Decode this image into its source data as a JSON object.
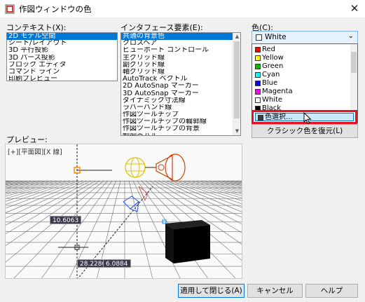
{
  "window": {
    "title": "作図ウィンドウの色",
    "close_glyph": "✕"
  },
  "context": {
    "label": "コンテキスト(X):",
    "items": [
      "2D モデル空間",
      "シート/レイアウト",
      "3D 平行投影",
      "3D パース投影",
      "ブロック エディタ",
      "コマンド ライン",
      "印刷プレビュー"
    ],
    "selected_index": 0
  },
  "interface": {
    "label": "インタフェース要素(E):",
    "items": [
      "共通の背景色",
      "クロスヘア",
      "ビューポート コントロール",
      "主グリッド線",
      "副グリッド線",
      "軸グリッド線",
      "AutoTrack ベクトル",
      "2D AutoSnap マーカー",
      "3D AutoSnap マーカー",
      "ダイナミック寸法線",
      "ラバーバンド線",
      "作図ツールチップ",
      "作図ツールチップの輪郭線",
      "作図ツールチップの背景",
      "制御点ハル"
    ],
    "selected_index": 0
  },
  "color": {
    "label": "色(C):",
    "current": "White",
    "current_color": "#ffffff",
    "options": [
      {
        "name": "Red",
        "color": "#ff0000"
      },
      {
        "name": "Yellow",
        "color": "#ffff00"
      },
      {
        "name": "Green",
        "color": "#00c000"
      },
      {
        "name": "Cyan",
        "color": "#00ffff"
      },
      {
        "name": "Blue",
        "color": "#0000ff"
      },
      {
        "name": "Magenta",
        "color": "#ff00ff"
      },
      {
        "name": "White",
        "color": "#ffffff"
      },
      {
        "name": "Black",
        "color": "#000000"
      }
    ],
    "select_color": "色選択...",
    "restore_button": "クラシック色を復元(L)",
    "highlight_color": "#e81123"
  },
  "preview": {
    "label": "プレビュー:",
    "viewport_label": "[+][平面図][X 線]",
    "coord_1": "10.6063",
    "coord_2": "28.2280",
    "coord_3": "6.0884"
  },
  "buttons": {
    "apply_close": "適用して閉じる(A)",
    "cancel": "キャンセル",
    "help": "ヘルプ"
  }
}
